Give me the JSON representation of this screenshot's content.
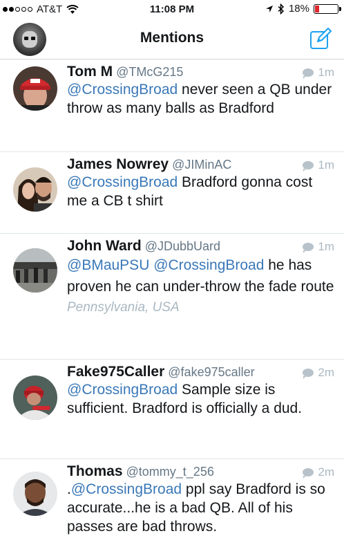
{
  "status_bar": {
    "carrier": "AT&T",
    "time": "11:08 PM",
    "battery": "18%",
    "battery_level": 0.18
  },
  "navbar": {
    "title": "Mentions",
    "avatar_icon": "profile-avatar",
    "compose_icon": "compose-icon"
  },
  "colors": {
    "mention": "#3a78b8",
    "meta": "#657786",
    "time": "#aab8c2",
    "battery_low": "#e0252d"
  },
  "tweets": [
    {
      "name": "Tom M",
      "handle": "@TMcG215",
      "time": "1m",
      "parts": [
        {
          "mention": "@CrossingBroad"
        },
        {
          "text": " never seen a QB under throw as many balls as Bradford"
        }
      ]
    },
    {
      "name": "James Nowrey",
      "handle": "@JIMinAC",
      "time": "1m",
      "parts": [
        {
          "mention": "@CrossingBroad"
        },
        {
          "text": " Bradford gonna cost me a CB t shirt"
        }
      ]
    },
    {
      "name": "John Ward",
      "handle": "@JDubbUard",
      "time": "1m",
      "parts": [
        {
          "mention": "@BMauPSU"
        },
        {
          "text": " "
        },
        {
          "mention": "@CrossingBroad"
        },
        {
          "text": " he has proven he can under-throw the fade route"
        }
      ],
      "location": "Pennsylvania, USA"
    },
    {
      "name": "Fake975Caller",
      "handle": "@fake975caller",
      "time": "2m",
      "parts": [
        {
          "mention": "@CrossingBroad"
        },
        {
          "text": " Sample size is sufficient. Bradford is officially a dud."
        }
      ]
    },
    {
      "name": "Thomas",
      "handle": "@tommy_t_256",
      "time": "2m",
      "parts": [
        {
          "text": "."
        },
        {
          "mention": "@CrossingBroad"
        },
        {
          "text": " ppl say Bradford is so accurate...he is a bad QB. All of his passes are bad throws."
        }
      ]
    }
  ]
}
